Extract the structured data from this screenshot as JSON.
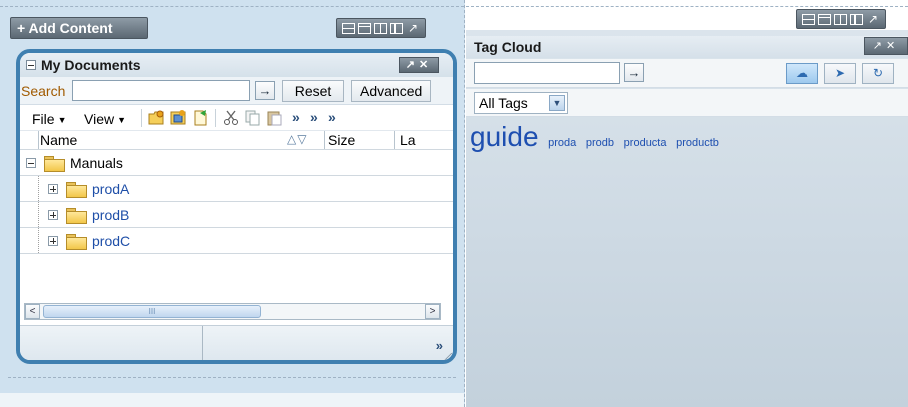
{
  "left_panel": {
    "add_content_label": "+ Add Content"
  },
  "my_documents": {
    "title": "My Documents",
    "close_label": "↗✕",
    "search_label": "Search",
    "search_value": "",
    "go_label": "→",
    "reset_label": "Reset",
    "advanced_label": "Advanced",
    "menus": [
      "File",
      "View"
    ],
    "more_label": "»",
    "columns": [
      "Name",
      "Size",
      "La"
    ],
    "sort_label": "△▽",
    "tree": [
      {
        "label": "Manuals",
        "expanded": true,
        "level": 0
      },
      {
        "label": "prodA",
        "expanded": false,
        "level": 1
      },
      {
        "label": "prodB",
        "expanded": false,
        "level": 1
      },
      {
        "label": "prodC",
        "expanded": false,
        "level": 1
      }
    ],
    "scroll_left": "<",
    "scroll_right": ">",
    "scroll_thumb": "III"
  },
  "tag_cloud": {
    "title": "Tag Cloud",
    "close_label": "↗✕",
    "search_value": "",
    "go_label": "→",
    "filter_value": "All Tags",
    "tags": [
      {
        "text": "guide",
        "size": "large"
      },
      {
        "text": "proda",
        "size": "small"
      },
      {
        "text": "prodb",
        "size": "small"
      },
      {
        "text": "producta",
        "size": "small"
      },
      {
        "text": "productb",
        "size": "small"
      }
    ],
    "view_buttons": [
      "cloud-view-icon",
      "tag-add-icon",
      "tag-refresh-icon"
    ]
  },
  "colors": {
    "accent": "#3f7fb0",
    "link": "#1f4fa8",
    "search_label": "#a05a00"
  }
}
